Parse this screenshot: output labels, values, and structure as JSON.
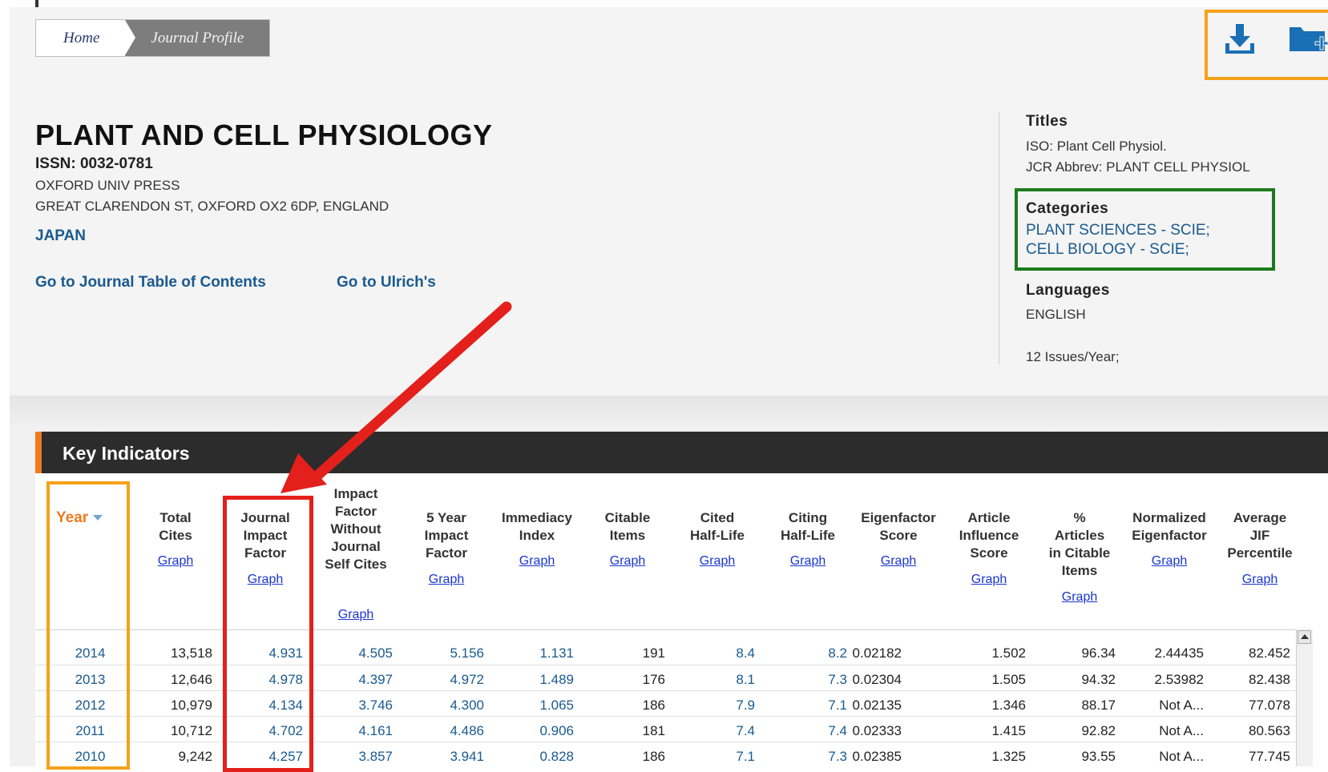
{
  "breadcrumb": {
    "home": "Home",
    "current": "Journal Profile"
  },
  "journal": {
    "title": "PLANT AND CELL PHYSIOLOGY",
    "issn": "ISSN: 0032-0781",
    "publisher": "OXFORD UNIV PRESS",
    "address": "GREAT CLARENDON ST, OXFORD OX2 6DP, ENGLAND",
    "country": "JAPAN"
  },
  "links": {
    "toc": "Go to Journal Table of Contents",
    "ulrich": "Go to Ulrich's"
  },
  "sidebar": {
    "titles_head": "Titles",
    "iso": "ISO: Plant Cell Physiol.",
    "jcr": "JCR Abbrev: PLANT CELL PHYSIOL",
    "categories_head": "Categories",
    "categories": [
      "PLANT SCIENCES - SCIE;",
      "CELL BIOLOGY - SCIE;"
    ],
    "languages_head": "Languages",
    "language": "ENGLISH",
    "issues": "12 Issues/Year;"
  },
  "actions": {
    "download_icon": "download-icon",
    "folder_icon": "add-to-folder-icon"
  },
  "key_indicators": {
    "title": "Key Indicators",
    "year_header": "Year",
    "graph_label": "Graph",
    "columns": [
      [
        "Total",
        "Cites"
      ],
      [
        "Journal",
        "Impact",
        "Factor"
      ],
      [
        "Impact",
        "Factor",
        "Without",
        "Journal",
        "Self Cites"
      ],
      [
        "5 Year",
        "Impact",
        "Factor"
      ],
      [
        "Immediacy",
        "Index"
      ],
      [
        "Citable",
        "Items"
      ],
      [
        "Cited",
        "Half-Life"
      ],
      [
        "Citing",
        "Half-Life"
      ],
      [
        "Eigenfactor",
        "Score"
      ],
      [
        "Article",
        "Influence",
        "Score"
      ],
      [
        "%",
        "Articles",
        "in Citable",
        "Items"
      ],
      [
        "Normalized",
        "Eigenfactor"
      ],
      [
        "Average",
        "JIF",
        "Percentile"
      ]
    ],
    "rows": [
      [
        "2014",
        "13,518",
        "4.931",
        "4.505",
        "5.156",
        "1.131",
        "191",
        "8.4",
        "8.2",
        "0.02182",
        "1.502",
        "96.34",
        "2.44435",
        "82.452"
      ],
      [
        "2013",
        "12,646",
        "4.978",
        "4.397",
        "4.972",
        "1.489",
        "176",
        "8.1",
        "7.3",
        "0.02304",
        "1.505",
        "94.32",
        "2.53982",
        "82.438"
      ],
      [
        "2012",
        "10,979",
        "4.134",
        "3.746",
        "4.300",
        "1.065",
        "186",
        "7.9",
        "7.1",
        "0.02135",
        "1.346",
        "88.17",
        "Not A...",
        "77.078"
      ],
      [
        "2011",
        "10,712",
        "4.702",
        "4.161",
        "4.486",
        "0.906",
        "181",
        "7.4",
        "7.4",
        "0.02333",
        "1.415",
        "92.82",
        "Not A...",
        "80.563"
      ],
      [
        "2010",
        "9,242",
        "4.257",
        "3.857",
        "3.941",
        "0.828",
        "186",
        "7.1",
        "7.3",
        "0.02385",
        "1.325",
        "93.55",
        "Not A...",
        "77.745"
      ]
    ]
  },
  "colors": {
    "accent_orange": "#f07a1e",
    "highlight_orange": "#f5a21b",
    "highlight_red": "#e3201b",
    "highlight_green": "#1d7a1d",
    "link_blue": "#1a5a8f"
  }
}
